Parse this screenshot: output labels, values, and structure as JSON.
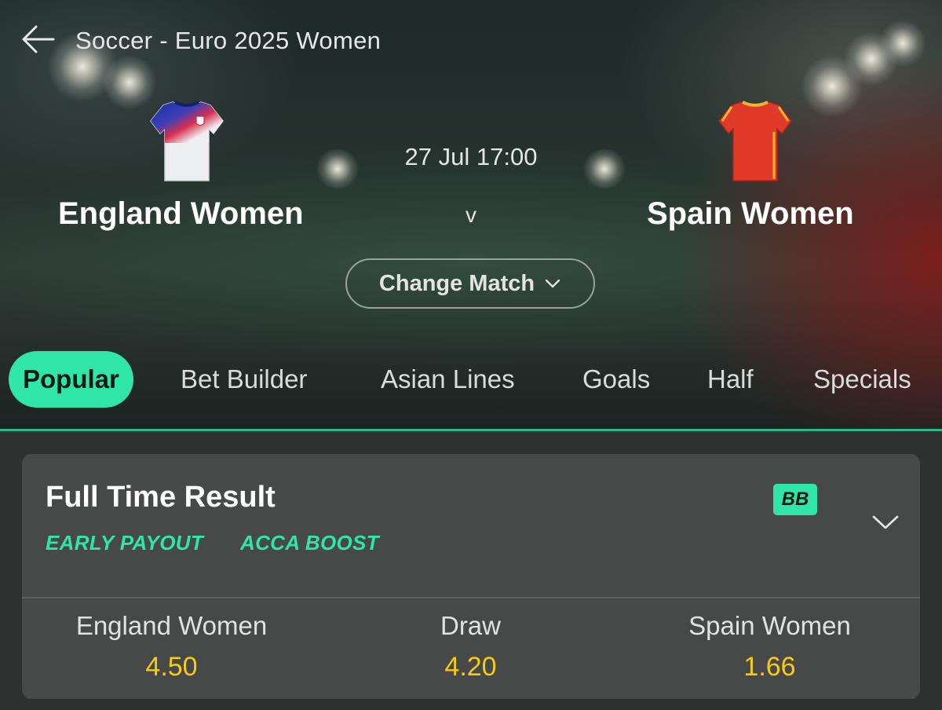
{
  "header": {
    "league": "Soccer - Euro 2025 Women",
    "back_icon": "back-arrow-icon"
  },
  "match": {
    "home": {
      "name": "England Women",
      "shirt_icon": "england-shirt-icon"
    },
    "away": {
      "name": "Spain Women",
      "shirt_icon": "spain-shirt-icon"
    },
    "datetime": "27 Jul 17:00",
    "vs": "v",
    "change_match_label": "Change Match"
  },
  "tabs": [
    {
      "label": "Popular",
      "active": true
    },
    {
      "label": "Bet Builder"
    },
    {
      "label": "Asian Lines"
    },
    {
      "label": "Goals"
    },
    {
      "label": "Half"
    },
    {
      "label": "Specials"
    }
  ],
  "market": {
    "title": "Full Time Result",
    "tags": [
      "EARLY PAYOUT",
      "ACCA BOOST"
    ],
    "badge": "BB",
    "outcomes": [
      {
        "name": "England Women",
        "odds": "4.50"
      },
      {
        "name": "Draw",
        "odds": "4.20"
      },
      {
        "name": "Spain Women",
        "odds": "1.66"
      }
    ]
  },
  "colors": {
    "accent": "#2fe5a8",
    "odds": "#f5cb15",
    "card": "#464948",
    "background": "#2f3131"
  }
}
